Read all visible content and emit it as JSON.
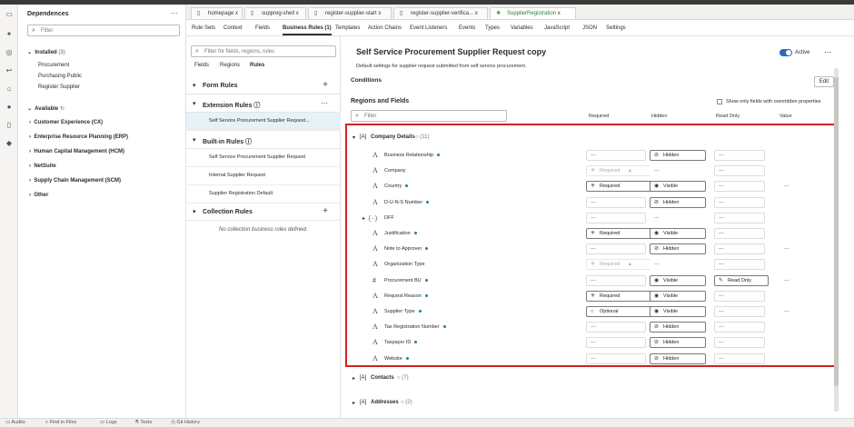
{
  "dependencies": {
    "title": "Dependences",
    "filter_placeholder": "Filter",
    "installed_label": "Installed",
    "installed_count": "(3)",
    "installed_items": [
      "Procurement",
      "Purchasing Public",
      "Register Supplier"
    ],
    "available_label": "Available",
    "available_items": [
      "Customer Experience (CX)",
      "Enterprise Resource Planning (ERP)",
      "Human Capital Management (HCM)",
      "NetSuite",
      "Supply Chain Management (SCM)",
      "Other"
    ]
  },
  "tabs": [
    {
      "label": "homepage",
      "close": "x"
    },
    {
      "label": "suppreg-shell",
      "close": "x"
    },
    {
      "label": "register-supplier-start",
      "close": "x"
    },
    {
      "label": "register-supplier-verifica...",
      "close": "x"
    },
    {
      "label": "SupplierRegistration",
      "close": "x"
    }
  ],
  "subtabs": [
    "Rule Sets",
    "Context",
    "Fields",
    "Business Rules (1)",
    "Templates",
    "Action Chains",
    "Event Listeners",
    "Events",
    "Types",
    "Variables",
    "JavaScript",
    "JSON",
    "Settings"
  ],
  "rules_panel": {
    "filter_placeholder": "Filter for fields, regions, rules",
    "view_tabs": [
      "Fields",
      "Regions",
      "Rules"
    ],
    "form_rules": "Form Rules",
    "extension_rules": "Extension Rules ⓘ",
    "extension_item": "Self Service Procurement Supplier Request...",
    "builtin_rules": "Built-in Rules ⓘ",
    "builtin_items": [
      "Self Service Procurement Supplier Request",
      "Internal Supplier Request",
      "Supplier Registration Default"
    ],
    "collection_rules": "Collection Rules",
    "no_collection": "No collection business rules defined."
  },
  "main": {
    "title": "Self Service Procurement Supplier Request copy",
    "description": "Default settings for supplier request submitted from self service procurement.",
    "active_label": "Active",
    "conditions": "Conditions",
    "edit": "Edit",
    "regions_fields": "Regions and Fields",
    "show_only": "Show only fields with overridden properties",
    "filter_placeholder": "Filter",
    "col_required": "Required",
    "col_hidden": "Hidden",
    "col_readonly": "Read Only",
    "col_value": "Value",
    "company_details": "Company Details",
    "company_count": "(11)",
    "contacts": "Contacts",
    "contacts_count": "(7)",
    "addresses": "Addresses",
    "addresses_count": "(2)"
  },
  "fields": [
    {
      "name": "Business Relationship",
      "dot": true,
      "icon": "A",
      "req": "—",
      "req_style": "plain",
      "hid": "Hidden",
      "hid_style": "hidden",
      "ro": "—",
      "val": ""
    },
    {
      "name": "Company",
      "dot": false,
      "icon": "A",
      "req": "Required",
      "req_style": "locked",
      "hid": "—",
      "hid_style": "plain",
      "ro": "—",
      "val": ""
    },
    {
      "name": "Country",
      "dot": true,
      "icon": "A",
      "req": "Required",
      "req_style": "required",
      "hid": "Visible",
      "hid_style": "visible",
      "ro": "—",
      "val": "—"
    },
    {
      "name": "D-U-N-S Number",
      "dot": true,
      "icon": "A",
      "req": "—",
      "req_style": "plain",
      "hid": "Hidden",
      "hid_style": "hidden",
      "ro": "—",
      "val": ""
    },
    {
      "name": "DFF",
      "dot": false,
      "icon": "{-}",
      "req": "—",
      "req_style": "plain",
      "hid": "—",
      "hid_style": "plain",
      "ro": "—",
      "val": ""
    },
    {
      "name": "Justification",
      "dot": true,
      "icon": "A",
      "req": "Required",
      "req_style": "required",
      "hid": "Visible",
      "hid_style": "visible",
      "ro": "—",
      "val": ""
    },
    {
      "name": "Note to Approver",
      "dot": true,
      "icon": "A",
      "req": "—",
      "req_style": "plain",
      "hid": "Hidden",
      "hid_style": "hidden",
      "ro": "—",
      "val": "—"
    },
    {
      "name": "Organization Type",
      "dot": false,
      "icon": "A",
      "req": "Required",
      "req_style": "locked",
      "hid": "—",
      "hid_style": "plain",
      "ro": "—",
      "val": ""
    },
    {
      "name": "Procurement BU",
      "dot": true,
      "icon": "#",
      "req": "—",
      "req_style": "plain",
      "hid": "Visible",
      "hid_style": "visible",
      "ro": "Read Only",
      "val": "—"
    },
    {
      "name": "Request Reason",
      "dot": true,
      "icon": "A",
      "req": "Required",
      "req_style": "required",
      "hid": "Visible",
      "hid_style": "visible",
      "ro": "—",
      "val": ""
    },
    {
      "name": "Supplier Type",
      "dot": true,
      "icon": "A",
      "req": "Optional",
      "req_style": "optional",
      "hid": "Visible",
      "hid_style": "visible",
      "ro": "—",
      "val": "—"
    },
    {
      "name": "Tax Registration Number",
      "dot": true,
      "icon": "A",
      "req": "—",
      "req_style": "plain",
      "hid": "Hidden",
      "hid_style": "hidden",
      "ro": "—",
      "val": ""
    },
    {
      "name": "Taxpayer ID",
      "dot": true,
      "icon": "A",
      "req": "—",
      "req_style": "plain",
      "hid": "Hidden",
      "hid_style": "hidden",
      "ro": "—",
      "val": ""
    },
    {
      "name": "Website",
      "dot": true,
      "icon": "A",
      "req": "—",
      "req_style": "plain",
      "hid": "Hidden",
      "hid_style": "hidden",
      "ro": "—",
      "val": ""
    }
  ],
  "bottom": [
    "Audits",
    "Find in Files",
    "Logs",
    "Tests",
    "Git History"
  ],
  "colors": {
    "accent": "#2a6bb3",
    "highlight": "#d32020",
    "dot": "#1c7fae",
    "active_tab": "#2e7d32"
  }
}
